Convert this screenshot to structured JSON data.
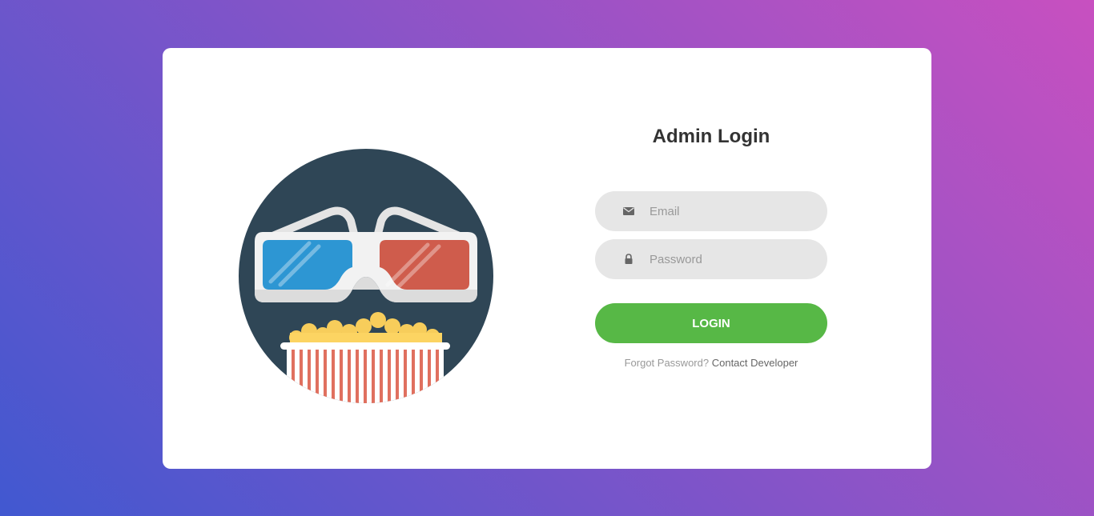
{
  "login": {
    "title": "Admin Login",
    "email_placeholder": "Email",
    "password_placeholder": "Password",
    "button_label": "LOGIN",
    "forgot_text": "Forgot Password?",
    "contact_link": "Contact Developer"
  },
  "icons": {
    "email": "envelope-icon",
    "password": "lock-icon",
    "illustration": "3d-glasses-popcorn-icon"
  },
  "colors": {
    "background_start": "#4158d0",
    "background_end": "#c850c0",
    "card": "#ffffff",
    "input_bg": "#e6e6e6",
    "button": "#57b846",
    "title": "#333333"
  }
}
